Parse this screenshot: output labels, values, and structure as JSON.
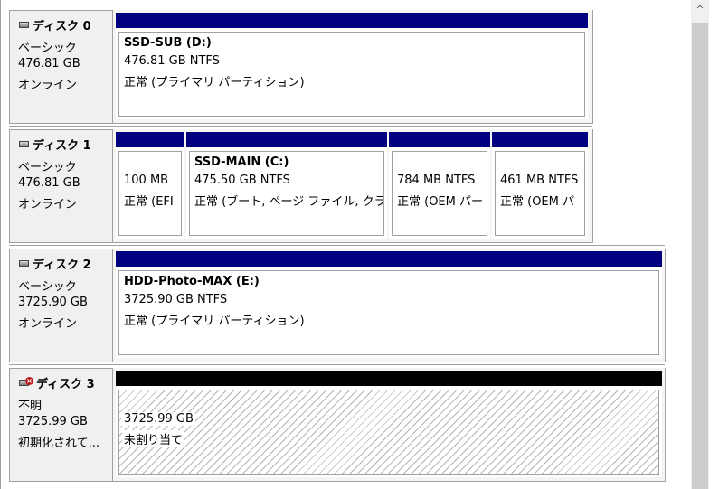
{
  "disks": [
    {
      "name": "ディスク 0",
      "type": "ベーシック",
      "size": "476.81 GB",
      "status": "オンライン",
      "icon": "disk-icon",
      "partitions": [
        {
          "label": "SSD-SUB  (D:)",
          "size": "476.81 GB NTFS",
          "status": "正常 (プライマリ パーティション)"
        }
      ]
    },
    {
      "name": "ディスク 1",
      "type": "ベーシック",
      "size": "476.81 GB",
      "status": "オンライン",
      "icon": "disk-icon",
      "partitions": [
        {
          "label": "",
          "size": "100 MB",
          "status": "正常 (EFI"
        },
        {
          "label": "SSD-MAIN  (C:)",
          "size": "475.50 GB NTFS",
          "status": "正常 (ブート, ページ ファイル, クラッシ"
        },
        {
          "label": "",
          "size": "784 MB NTFS",
          "status": "正常 (OEM パー"
        },
        {
          "label": "",
          "size": "461 MB NTFS",
          "status": "正常 (OEM パ-"
        }
      ]
    },
    {
      "name": "ディスク 2",
      "type": "ベーシック",
      "size": "3725.90 GB",
      "status": "オンライン",
      "icon": "disk-icon",
      "partitions": [
        {
          "label": "HDD-Photo-MAX  (E:)",
          "size": "3725.90 GB NTFS",
          "status": "正常 (プライマリ パーティション)"
        }
      ]
    },
    {
      "name": "ディスク 3",
      "type": "不明",
      "size": "3725.99 GB",
      "status": "初期化されて...",
      "icon": "disk-error-icon",
      "partitions": [
        {
          "label": "",
          "size": "3725.99 GB",
          "status": "未割り当て"
        }
      ]
    }
  ],
  "scrollbar": {
    "up_arrow": "^"
  },
  "colors": {
    "primary_bar": "#000080",
    "unallocated_bar": "#000000",
    "label_bg": "#f0f0f0"
  }
}
